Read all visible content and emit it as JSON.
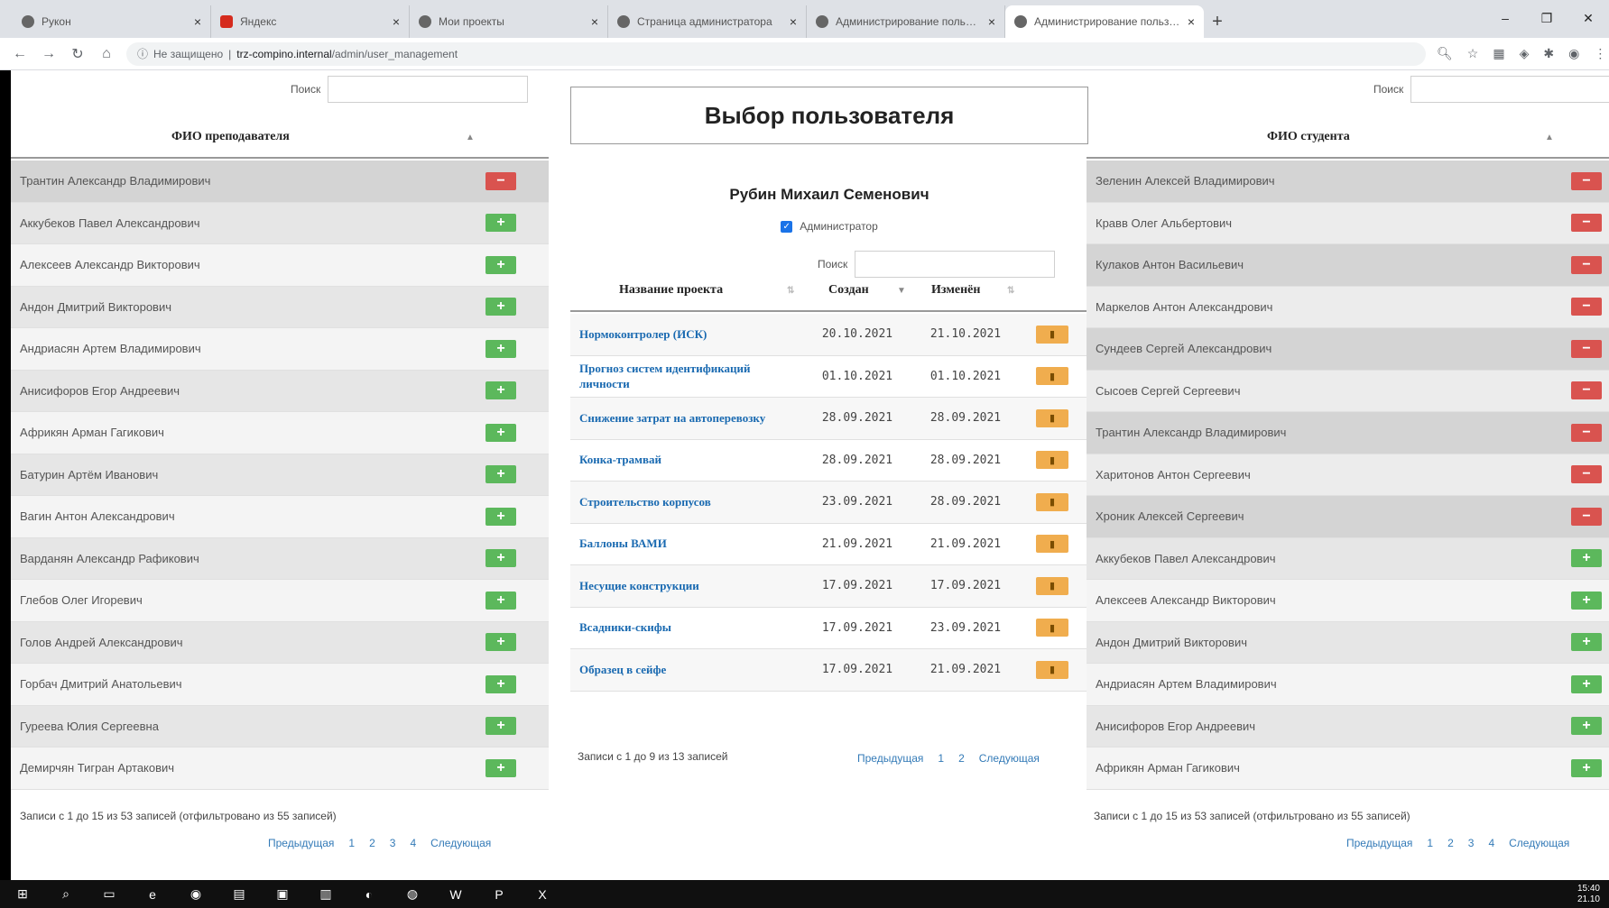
{
  "browser": {
    "tabs": [
      {
        "label": "Рукон"
      },
      {
        "label": "Яндекс"
      },
      {
        "label": "Мои проекты"
      },
      {
        "label": "Страница администратора"
      },
      {
        "label": "Администрирование пользоват"
      },
      {
        "label": "Администрирование пользоват"
      }
    ],
    "url_prefix": "Не защищено",
    "url_host": "trz-compino.internal",
    "url_path": "/admin/user_management"
  },
  "left_panel": {
    "search_label": "Поиск",
    "search_value": "",
    "column_header": "ФИО преподавателя",
    "rows": [
      {
        "name": "Трантин Александр Владимирович",
        "action": "remove"
      },
      {
        "name": "Аккубеков Павел Александрович",
        "action": "add"
      },
      {
        "name": "Алексеев Александр Викторович",
        "action": "add"
      },
      {
        "name": "Андон Дмитрий Викторович",
        "action": "add"
      },
      {
        "name": "Андриасян Артем Владимирович",
        "action": "add"
      },
      {
        "name": "Анисифоров Егор Андреевич",
        "action": "add"
      },
      {
        "name": "Африкян Арман Гагикович",
        "action": "add"
      },
      {
        "name": "Батурин Артём Иванович",
        "action": "add"
      },
      {
        "name": "Вагин Антон Александрович",
        "action": "add"
      },
      {
        "name": "Варданян Александр Рафикович",
        "action": "add"
      },
      {
        "name": "Глебов Олег Игоревич",
        "action": "add"
      },
      {
        "name": "Голов Андрей Александрович",
        "action": "add"
      },
      {
        "name": "Горбач Дмитрий Анатольевич",
        "action": "add"
      },
      {
        "name": "Гуреева Юлия Сергеевна",
        "action": "add"
      },
      {
        "name": "Демирчян Тигран Артакович",
        "action": "add"
      }
    ],
    "info": "Записи с 1 до 15 из 53 записей (отфильтровано из 55 записей)",
    "pager": {
      "prev": "Предыдущая",
      "pages": [
        "1",
        "2",
        "3",
        "4"
      ],
      "next": "Следующая"
    }
  },
  "center": {
    "title": "Выбор пользователя",
    "user_name": "Рубин Михаил Семенович",
    "admin_label": "Администратор",
    "search_label": "Поиск",
    "search_value": "",
    "headers": {
      "name": "Название проекта",
      "created": "Создан",
      "modified": "Изменён"
    },
    "projects": [
      {
        "name": "Нормоконтролер (ИСК)",
        "created": "20.10.2021",
        "modified": "21.10.2021"
      },
      {
        "name": "Прогноз систем идентификаций личности",
        "created": "01.10.2021",
        "modified": "01.10.2021"
      },
      {
        "name": "Снижение затрат на автоперевозку",
        "created": "28.09.2021",
        "modified": "28.09.2021"
      },
      {
        "name": "Конка-трамвай",
        "created": "28.09.2021",
        "modified": "28.09.2021"
      },
      {
        "name": "Строительство корпусов",
        "created": "23.09.2021",
        "modified": "28.09.2021"
      },
      {
        "name": "Баллоны ВАМИ",
        "created": "21.09.2021",
        "modified": "21.09.2021"
      },
      {
        "name": "Несущие конструкции",
        "created": "17.09.2021",
        "modified": "17.09.2021"
      },
      {
        "name": "Всадники-скифы",
        "created": "17.09.2021",
        "modified": "23.09.2021"
      },
      {
        "name": "Образец в сейфе",
        "created": "17.09.2021",
        "modified": "21.09.2021"
      }
    ],
    "info": "Записи с 1 до 9 из 13 записей",
    "pager": {
      "prev": "Предыдущая",
      "pages": [
        "1",
        "2"
      ],
      "next": "Следующая"
    }
  },
  "right_panel": {
    "search_label": "Поиск",
    "search_value": "",
    "column_header": "ФИО студента",
    "rows": [
      {
        "name": "Зеленин Алексей Владимирович",
        "action": "remove"
      },
      {
        "name": "Кравв Олег Альбертович",
        "action": "remove"
      },
      {
        "name": "Кулаков Антон Васильевич",
        "action": "remove"
      },
      {
        "name": "Маркелов Антон Александрович",
        "action": "remove"
      },
      {
        "name": "Сундеев Сергей Александрович",
        "action": "remove"
      },
      {
        "name": "Сысоев Сергей Сергеевич",
        "action": "remove"
      },
      {
        "name": "Трантин Александр Владимирович",
        "action": "remove"
      },
      {
        "name": "Харитонов Антон Сергеевич",
        "action": "remove"
      },
      {
        "name": "Хроник Алексей Сергеевич",
        "action": "remove"
      },
      {
        "name": "Аккубеков Павел Александрович",
        "action": "add"
      },
      {
        "name": "Алексеев Александр Викторович",
        "action": "add"
      },
      {
        "name": "Андон Дмитрий Викторович",
        "action": "add"
      },
      {
        "name": "Андриасян Артем Владимирович",
        "action": "add"
      },
      {
        "name": "Анисифоров Егор Андреевич",
        "action": "add"
      },
      {
        "name": "Африкян Арман Гагикович",
        "action": "add"
      }
    ],
    "info": "Записи с 1 до 15 из 53 записей (отфильтровано из 55 записей)",
    "pager": {
      "prev": "Предыдущая",
      "pages": [
        "1",
        "2",
        "3",
        "4"
      ],
      "next": "Следующая"
    }
  },
  "taskbar": {
    "time": "15:40",
    "date": "21.10"
  },
  "colors": {
    "add": "#5cb85c",
    "remove": "#d9534f",
    "edit": "#f0ad4e",
    "link": "#1a6ab1",
    "row_selected": "#d4d4d4",
    "row_alt": "#e6e6e6"
  }
}
